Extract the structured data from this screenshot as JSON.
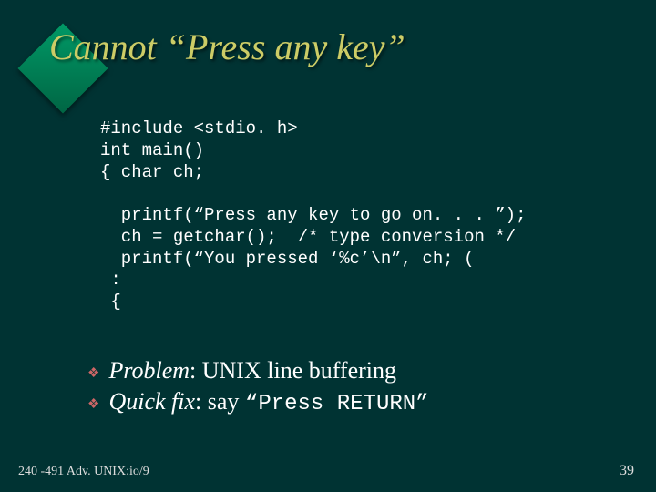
{
  "title": "Cannot “Press any key”",
  "code": {
    "l1": "#include <stdio. h>",
    "l2": "int main()",
    "l3": "{ char ch;",
    "l4": "",
    "l5": "  printf(“Press any key to go on. . . ”);",
    "l6": "  ch = getchar();  /* type conversion */",
    "l7": "  printf(“You pressed ‘%c’\\n”, ch; (",
    "l8": " :",
    "l9": " {"
  },
  "bullets": {
    "b1": {
      "label": "Problem",
      "rest": ": UNIX line buffering"
    },
    "b2": {
      "label": "Quick fix",
      "rest_a": ": say ",
      "mono": "“Press RETURN”"
    }
  },
  "footer": {
    "left": "240 -491 Adv. UNIX:io/9",
    "right": "39"
  }
}
